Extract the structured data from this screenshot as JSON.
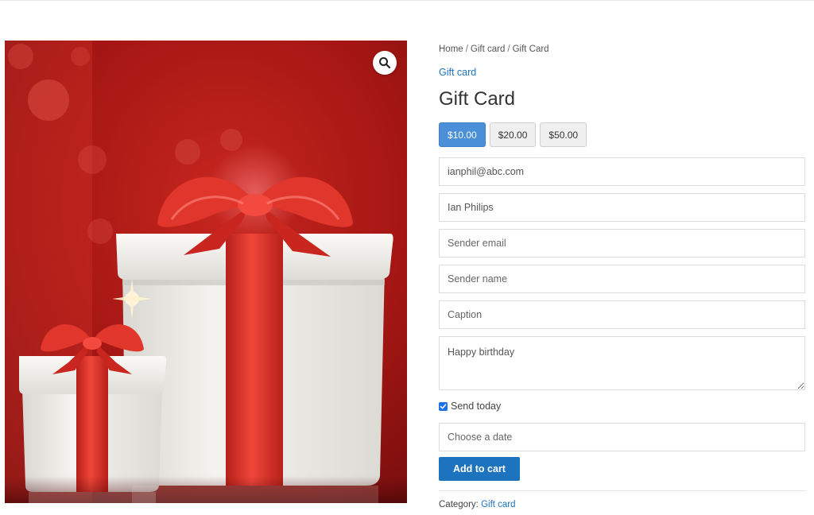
{
  "breadcrumb": {
    "items": [
      "Home",
      "Gift card",
      "Gift Card"
    ],
    "separator": "/"
  },
  "product": {
    "category_link": "Gift card",
    "title": "Gift Card",
    "image_alt": "Two white gift boxes with red ribbon bows on a red background"
  },
  "amounts": {
    "options": [
      "$10.00",
      "$20.00",
      "$50.00"
    ],
    "selected": "$10.00"
  },
  "form": {
    "recipient_email": {
      "value": "ianphil@abc.com",
      "placeholder": ""
    },
    "recipient_name": {
      "value": "Ian Philips",
      "placeholder": ""
    },
    "sender_email": {
      "value": "",
      "placeholder": "Sender email"
    },
    "sender_name": {
      "value": "",
      "placeholder": "Sender name"
    },
    "caption": {
      "value": "",
      "placeholder": "Caption"
    },
    "message": {
      "value": "Happy birthday",
      "placeholder": ""
    },
    "send_today": {
      "label": "Send today",
      "checked": true
    },
    "date": {
      "value": "",
      "placeholder": "Choose a date"
    },
    "add_to_cart_label": "Add to cart"
  },
  "meta": {
    "category_label": "Category:",
    "category_value": "Gift card"
  },
  "icons": {
    "zoom": "magnifier-icon",
    "checkbox": "checkmark-icon"
  },
  "colors": {
    "link": "#1e73be",
    "selected_amount": "#4a90d9",
    "button": "#1e73be",
    "image_background": "#b81f1c",
    "ribbon": "#e0362b"
  }
}
